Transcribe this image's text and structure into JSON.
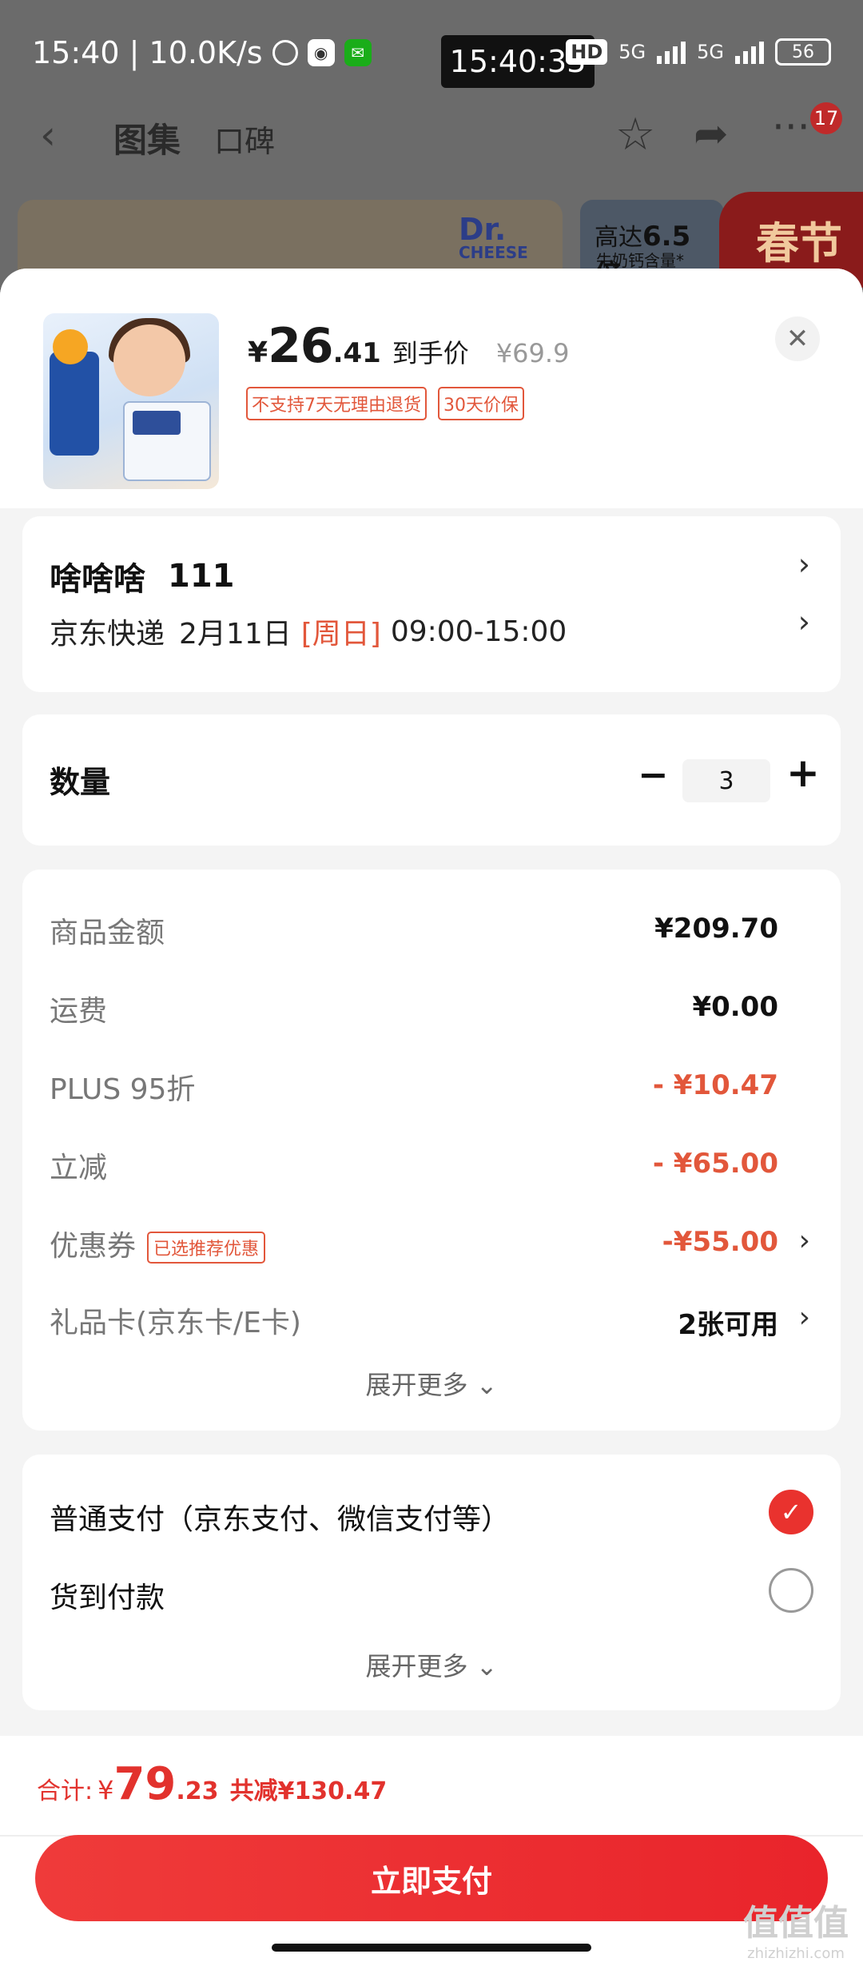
{
  "status_bar": {
    "left_text": "15:40 | 10.0K/s",
    "center_time": "15:40:33",
    "hd_badge": "HD",
    "network": "5G",
    "network2": "5G",
    "battery": "56"
  },
  "nav": {
    "back_icon": "back-arrow-icon",
    "tab_gallery": "图集",
    "tab_reviews": "口碑",
    "star_icon": "star-icon",
    "share_icon": "share-icon",
    "more_icon": "more-icon",
    "badge_count": "17"
  },
  "background": {
    "brand_line1": "Dr.",
    "brand_line2": "CHEESE",
    "promo_text_prefix": "高达",
    "promo_text_value": "6.5倍",
    "promo_sub": "牛奶钙含量*",
    "festival_text": "春节"
  },
  "product": {
    "price_symbol": "¥",
    "price_int": "26",
    "price_dec": ".41",
    "price_label": "到手价",
    "original_price": "¥69.9",
    "tags": [
      "不支持7天无理由退货",
      "30天价保"
    ],
    "close_icon": "close-icon"
  },
  "address": {
    "name": "啥啥啥",
    "phone": "111",
    "courier": "京东快递",
    "date": "2月11日",
    "weekday": "[周日]",
    "time_window": "09:00-15:00"
  },
  "quantity": {
    "label": "数量",
    "value": "3",
    "minus": "−",
    "plus": "+"
  },
  "fees": {
    "goods_amount_label": "商品金额",
    "goods_amount_value": "¥209.70",
    "shipping_label": "运费",
    "shipping_value": "¥0.00",
    "plus_label": "PLUS 95折",
    "plus_value": "- ¥10.47",
    "instant_label": "立减",
    "instant_value": "- ¥65.00",
    "coupon_label": "优惠券",
    "coupon_tag": "已选推荐优惠",
    "coupon_value": "-¥55.00",
    "giftcard_label": "礼品卡(京东卡/E卡)",
    "giftcard_value": "2张可用",
    "expand_more": "展开更多"
  },
  "payment": {
    "option1": "普通支付（京东支付、微信支付等）",
    "option2": "货到付款",
    "selected": 0,
    "expand_more": "展开更多"
  },
  "total": {
    "label": "合计:",
    "symbol": "¥",
    "int": "79",
    "dec": ".23",
    "saved": "共减¥130.47",
    "pay_button": "立即支付"
  },
  "watermark": {
    "text": "值值值",
    "domain": "zhizhizhi.com"
  },
  "colors": {
    "accent_red": "#e9322e",
    "price_red": "#e2573b"
  }
}
